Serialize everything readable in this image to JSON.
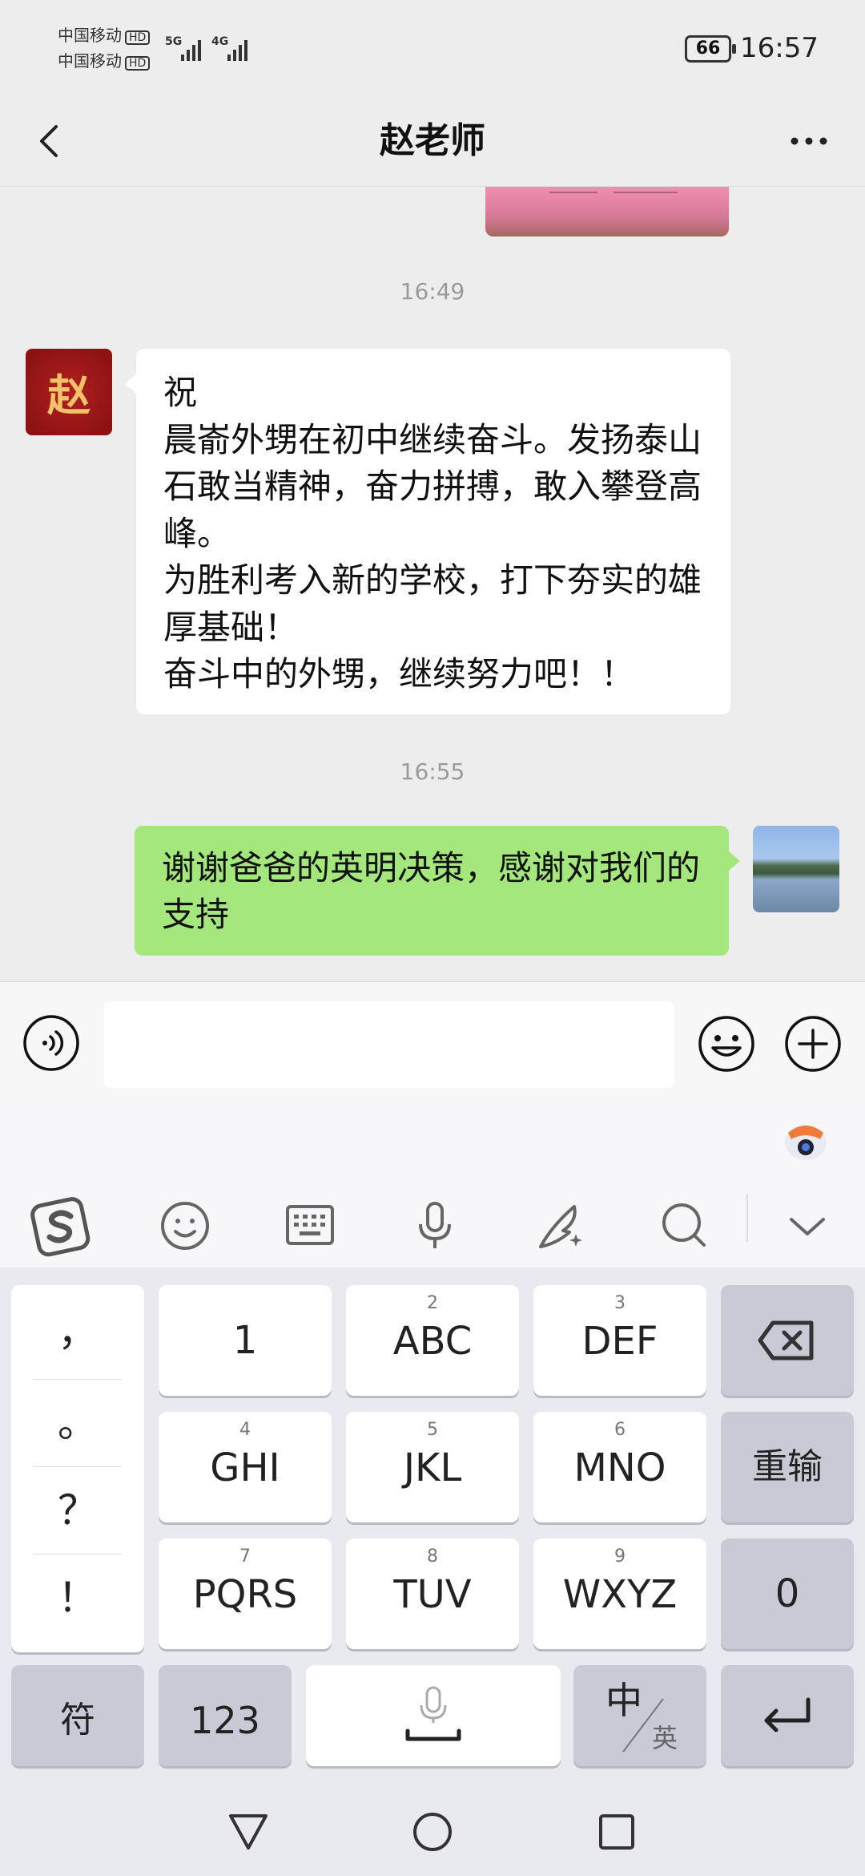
{
  "status_bar": {
    "carrier1": "中国移动",
    "carrier2": "中国移动",
    "hd": "HD",
    "net1": "5G",
    "net2": "4G",
    "battery": "66",
    "time": "16:57"
  },
  "header": {
    "title": "赵老师"
  },
  "messages": {
    "ts1": "16:49",
    "incoming_text": "祝\n晨嵛外甥在初中继续奋斗。发扬泰山石敢当精神，奋力拼搏，敢入攀登高峰。\n为胜利考入新的学校，打下夯实的雄厚基础！\n奋斗中的外甥，继续努力吧！！",
    "incoming_avatar_glyph": "赵",
    "ts2": "16:55",
    "outgoing_text": "谢谢爸爸的英明决策，感谢对我们的支持"
  },
  "input": {
    "value": ""
  },
  "keyboard": {
    "punct": [
      "，",
      "。",
      "？",
      "！"
    ],
    "rows": [
      [
        {
          "num": "",
          "label": "1"
        },
        {
          "num": "2",
          "label": "ABC"
        },
        {
          "num": "3",
          "label": "DEF"
        }
      ],
      [
        {
          "num": "4",
          "label": "GHI"
        },
        {
          "num": "5",
          "label": "JKL"
        },
        {
          "num": "6",
          "label": "MNO"
        }
      ],
      [
        {
          "num": "7",
          "label": "PQRS"
        },
        {
          "num": "8",
          "label": "TUV"
        },
        {
          "num": "9",
          "label": "WXYZ"
        }
      ]
    ],
    "reinput": "重输",
    "zero": "0",
    "symbols": "符",
    "numbers": "123",
    "lang_main": "中",
    "lang_sub": "英"
  },
  "colors": {
    "outgoing_bubble": "#a4e77c",
    "incoming_bubble": "#ffffff",
    "chat_bg": "#ededed"
  }
}
